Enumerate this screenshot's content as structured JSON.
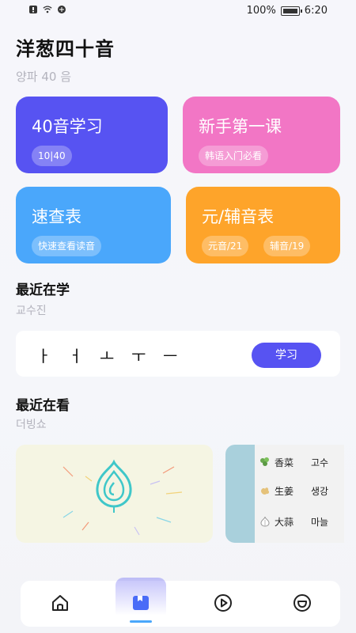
{
  "status_bar": {
    "battery": "100%",
    "time": "6:20"
  },
  "header": {
    "title": "洋葱四十音",
    "subtitle": "양파 40 음"
  },
  "cards": [
    {
      "title": "40音学习",
      "chips": [
        "10|40"
      ]
    },
    {
      "title": "新手第一课",
      "chips": [
        "韩语入门必看"
      ]
    },
    {
      "title": "速查表",
      "chips": [
        "快速查看读音"
      ]
    },
    {
      "title": "元/辅音表",
      "chips": [
        "元音/21",
        "辅音/19"
      ]
    }
  ],
  "recent_study": {
    "title": "最近在学",
    "subtitle": "교수진",
    "glyphs": [
      "ㅏ",
      "ㅓ",
      "ㅗ",
      "ㅜ",
      "ㅡ"
    ],
    "button": "学习"
  },
  "recent_watch": {
    "title": "最近在看",
    "subtitle": "더빙쇼",
    "vocab": [
      {
        "cn": "香菜",
        "kr": "고수",
        "icon": "coriander-icon"
      },
      {
        "cn": "生姜",
        "kr": "생강",
        "icon": "ginger-icon"
      },
      {
        "cn": "大蒜",
        "kr": "마늘",
        "icon": "garlic-icon"
      }
    ]
  },
  "tabbar": {
    "items": [
      "home-icon",
      "book-icon",
      "play-icon",
      "smile-icon"
    ],
    "active": 1
  },
  "colors": {
    "primary": "#5753f2",
    "pink": "#f276c5",
    "blue": "#4aa7fb",
    "orange": "#fea42a"
  }
}
